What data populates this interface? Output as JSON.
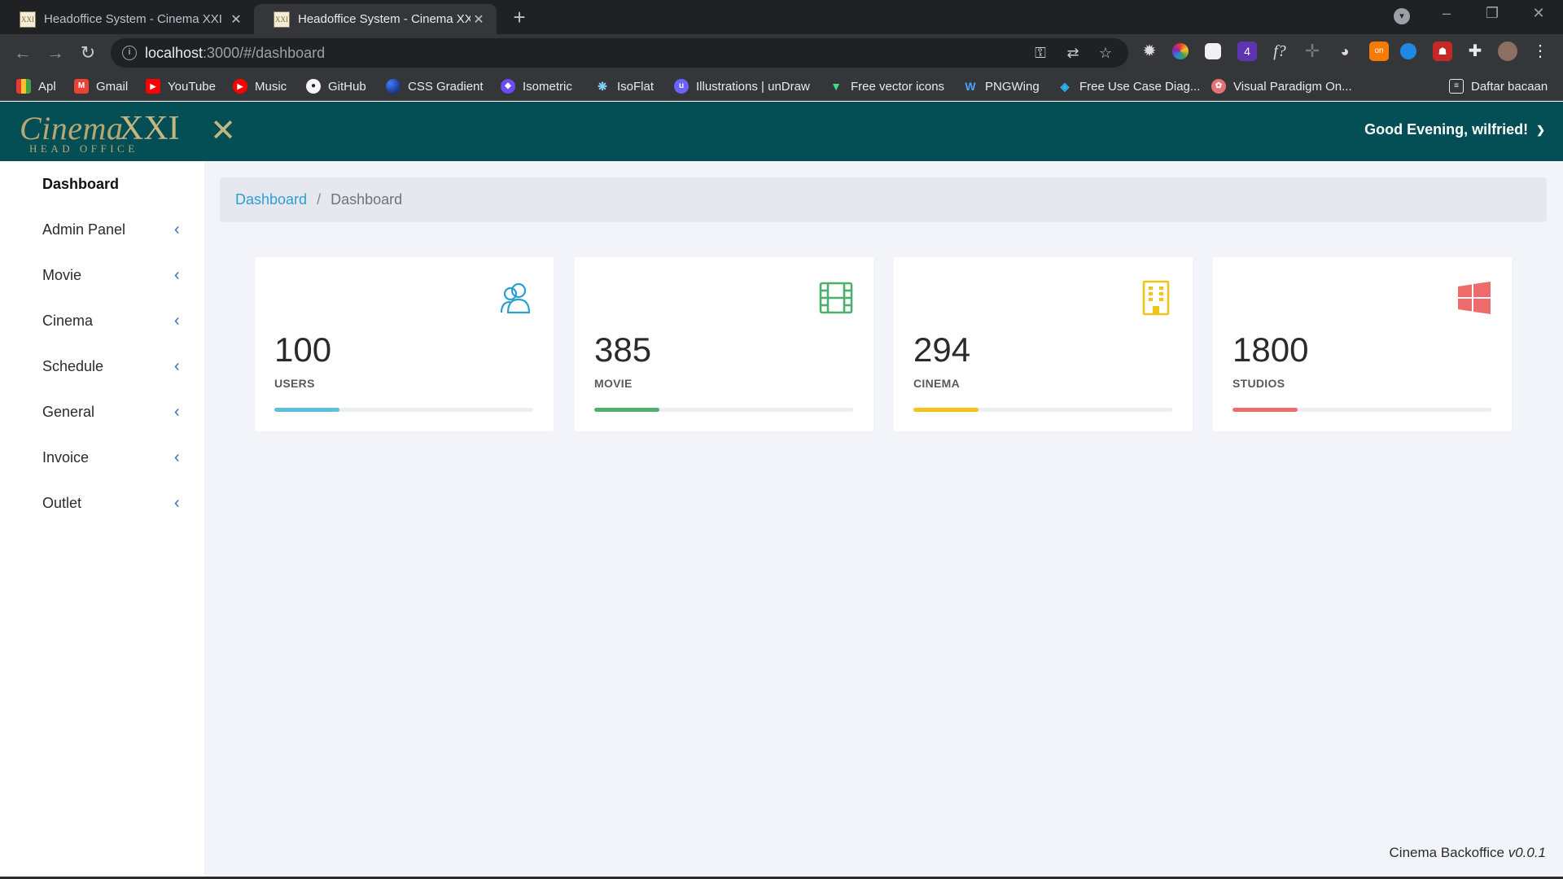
{
  "browser": {
    "tabs": [
      {
        "title": "Headoffice System - Cinema XXI",
        "favicon": "XXI",
        "active": false
      },
      {
        "title": "Headoffice System - Cinema XXI",
        "favicon": "XXI",
        "active": true
      }
    ],
    "new_tab_icon": "plus-icon",
    "url_host": "localhost",
    "url_rest": ":3000/#/dashboard",
    "bookmarks": [
      {
        "label": "Apl",
        "icon": "apps-grid-icon"
      },
      {
        "label": "Gmail",
        "icon": "gmail-icon"
      },
      {
        "label": "YouTube",
        "icon": "youtube-icon"
      },
      {
        "label": "Music",
        "icon": "youtube-music-icon"
      },
      {
        "label": "GitHub",
        "icon": "github-icon"
      },
      {
        "label": "CSS Gradient",
        "icon": "css-gradient-icon"
      },
      {
        "label": "Isometric",
        "icon": "isometric-icon"
      },
      {
        "label": "IsoFlat",
        "icon": "isoflat-icon"
      },
      {
        "label": "Illustrations | unDraw",
        "icon": "undraw-icon"
      },
      {
        "label": "Free vector icons",
        "icon": "vector-icons-icon"
      },
      {
        "label": "PNGWing",
        "icon": "pngwing-icon"
      },
      {
        "label": "Free Use Case Diag...",
        "icon": "diagram-icon"
      },
      {
        "label": "Visual Paradigm On...",
        "icon": "visual-paradigm-icon"
      }
    ],
    "reading_list": "Daftar bacaan"
  },
  "header": {
    "logo_script": "Cinema",
    "logo_xxi": "XXI",
    "logo_sub": "HEAD OFFICE",
    "greeting": "Good Evening, wilfried!"
  },
  "sidebar": {
    "items": [
      {
        "label": "Dashboard",
        "active": true,
        "expandable": false
      },
      {
        "label": "Admin Panel",
        "active": false,
        "expandable": true
      },
      {
        "label": "Movie",
        "active": false,
        "expandable": true
      },
      {
        "label": "Cinema",
        "active": false,
        "expandable": true
      },
      {
        "label": "Schedule",
        "active": false,
        "expandable": true
      },
      {
        "label": "General",
        "active": false,
        "expandable": true
      },
      {
        "label": "Invoice",
        "active": false,
        "expandable": true
      },
      {
        "label": "Outlet",
        "active": false,
        "expandable": true
      }
    ]
  },
  "breadcrumb": {
    "link": "Dashboard",
    "current": "Dashboard"
  },
  "cards": [
    {
      "value": "100",
      "label": "USERS",
      "icon": "users-icon",
      "color": "#5bc0de",
      "progress": 0.25
    },
    {
      "value": "385",
      "label": "MOVIE",
      "icon": "film-icon",
      "color": "#4caf6e",
      "progress": 0.25
    },
    {
      "value": "294",
      "label": "CINEMA",
      "icon": "building-icon",
      "color": "#f0c419",
      "progress": 0.25
    },
    {
      "value": "1800",
      "label": "STUDIOS",
      "icon": "windows-icon",
      "color": "#ef6b6b",
      "progress": 0.25
    }
  ],
  "footer": {
    "name": "Cinema Backoffice",
    "version": "v0.0.1"
  }
}
